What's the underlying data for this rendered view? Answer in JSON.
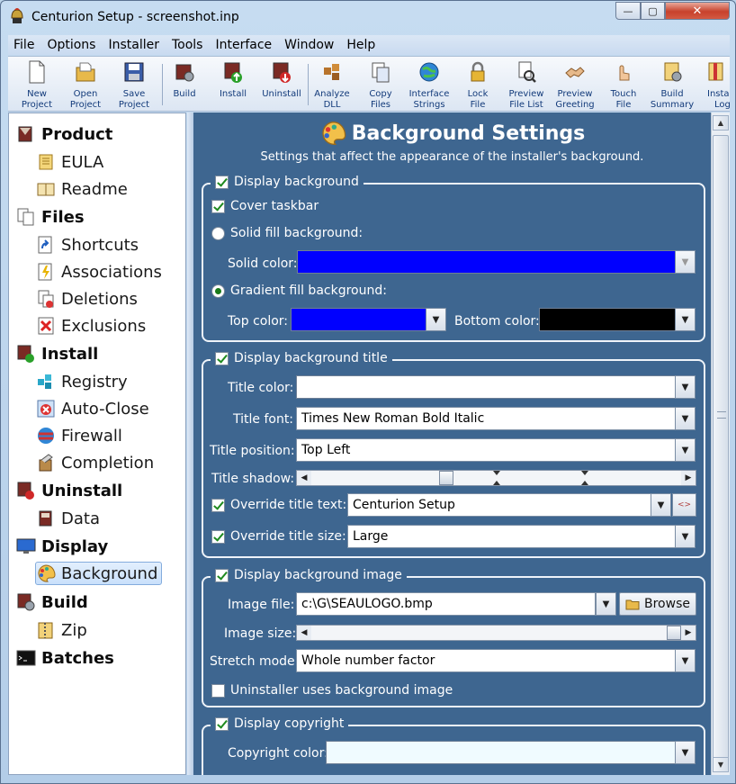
{
  "window": {
    "title": "Centurion Setup - screenshot.inp",
    "min_glyph": "—",
    "max_glyph": "▢",
    "close_glyph": "✕"
  },
  "menu": [
    "File",
    "Options",
    "Installer",
    "Tools",
    "Interface",
    "Window",
    "Help"
  ],
  "toolbar": [
    {
      "line1": "New",
      "line2": "Project",
      "icon": "new-project-icon"
    },
    {
      "line1": "Open",
      "line2": "Project",
      "icon": "open-project-icon"
    },
    {
      "line1": "Save",
      "line2": "Project",
      "icon": "save-project-icon"
    },
    {
      "line1": "Build",
      "line2": "",
      "icon": "build-icon"
    },
    {
      "line1": "Install",
      "line2": "",
      "icon": "install-icon"
    },
    {
      "line1": "Uninstall",
      "line2": "",
      "icon": "uninstall-icon"
    },
    {
      "line1": "Analyze",
      "line2": "DLL",
      "icon": "analyze-dll-icon"
    },
    {
      "line1": "Copy",
      "line2": "Files",
      "icon": "copy-files-icon"
    },
    {
      "line1": "Interface",
      "line2": "Strings",
      "icon": "interface-strings-icon"
    },
    {
      "line1": "Lock",
      "line2": "File",
      "icon": "lock-file-icon"
    },
    {
      "line1": "Preview",
      "line2": "File List",
      "icon": "preview-file-list-icon"
    },
    {
      "line1": "Preview",
      "line2": "Greeting",
      "icon": "preview-greeting-icon"
    },
    {
      "line1": "Touch",
      "line2": "File",
      "icon": "touch-file-icon"
    },
    {
      "line1": "Build",
      "line2": "Summary",
      "icon": "build-summary-icon"
    },
    {
      "line1": "Insta",
      "line2": "Log",
      "icon": "install-log-icon"
    }
  ],
  "nav": {
    "product": "Product",
    "eula": "EULA",
    "readme": "Readme",
    "files": "Files",
    "shortcuts": "Shortcuts",
    "associations": "Associations",
    "deletions": "Deletions",
    "exclusions": "Exclusions",
    "install": "Install",
    "registry": "Registry",
    "autoclose": "Auto-Close",
    "firewall": "Firewall",
    "completion": "Completion",
    "uninstall": "Uninstall",
    "data": "Data",
    "display": "Display",
    "background": "Background",
    "build": "Build",
    "zip": "Zip",
    "batches": "Batches"
  },
  "header": {
    "title": "Background Settings",
    "subtitle": "Settings that affect the appearance of the installer's background."
  },
  "bg_group": {
    "legend": "Display background",
    "cover_taskbar": "Cover taskbar",
    "solid_fill": "Solid fill background:",
    "solid_color_label": "Solid color:",
    "solid_color": "#0000ff",
    "gradient_fill": "Gradient fill background:",
    "top_color_label": "Top color:",
    "top_color": "#0000ff",
    "bottom_color_label": "Bottom color:",
    "bottom_color": "#000000",
    "display_background_checked": true,
    "cover_taskbar_checked": true,
    "solid_fill_selected": false,
    "gradient_fill_selected": true
  },
  "title_group": {
    "legend": "Display background title",
    "title_color_label": "Title color:",
    "title_color": "#ffffff",
    "title_font_label": "Title font:",
    "title_font": "Times New Roman Bold Italic",
    "title_position_label": "Title position:",
    "title_position": "Top Left",
    "title_shadow_label": "Title shadow:",
    "title_shadow": 0.36,
    "override_text_label": "Override title text:",
    "override_text": "Centurion Setup",
    "override_size_label": "Override title size:",
    "override_size": "Large"
  },
  "image_group": {
    "legend": "Display background image",
    "image_file_label": "Image file:",
    "image_file": "c:\\G\\SEAULOGO.bmp",
    "browse": "Browse",
    "image_size_label": "Image size:",
    "image_size": 1.0,
    "stretch_mode_label": "Stretch mode:",
    "stretch_mode": "Whole number factor",
    "uninstaller_uses": "Uninstaller uses background image"
  },
  "copyright_group": {
    "legend": "Display copyright",
    "copyright_color_label": "Copyright color:",
    "copyright_color": "#f0fbff"
  },
  "colors": {
    "panel_bg": "#3e6690",
    "accent_green": "#1f8a1f"
  }
}
